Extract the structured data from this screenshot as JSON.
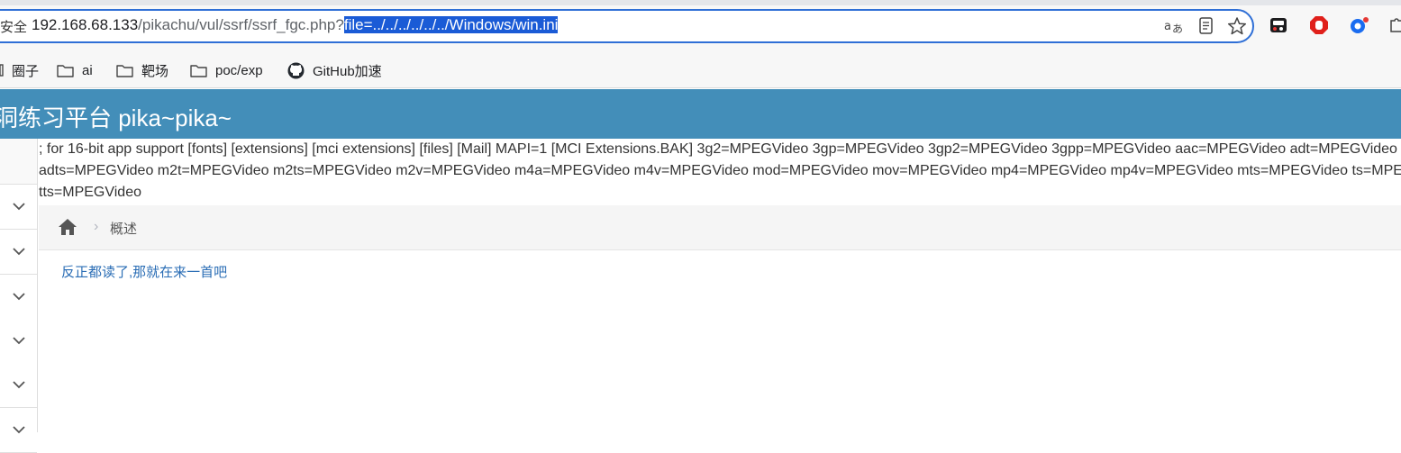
{
  "browser": {
    "security_label": "安全",
    "url_host": "192.168.68.133",
    "url_path": "/pikachu/vul/ssrf/ssrf_fgc.php?",
    "url_selected": "file=../../../../../../Windows/win.ini",
    "icons": [
      "read-aloud-icon",
      "reader-mode-icon",
      "favorite-star-icon",
      "extension-icon",
      "adblock-icon",
      "copilot-icon",
      "extensions-puzzle-icon"
    ]
  },
  "bookmarks": [
    {
      "label": "圈子",
      "icon": "folder-icon"
    },
    {
      "label": "ai",
      "icon": "folder-icon"
    },
    {
      "label": "靶场",
      "icon": "folder-icon"
    },
    {
      "label": "poc/exp",
      "icon": "folder-icon"
    },
    {
      "label": "GitHub加速",
      "icon": "github-icon"
    }
  ],
  "header": {
    "title": "洞练习平台 pika~pika~"
  },
  "output": {
    "lines": [
      "; for 16-bit app support [fonts] [extensions] [mci extensions] [files] [Mail] MAPI=1 [MCI Extensions.BAK] 3g2=MPEGVideo 3gp=MPEGVideo 3gp2=MPEGVideo 3gpp=MPEGVideo aac=MPEGVideo adt=MPEGVideo",
      "adts=MPEGVideo m2t=MPEGVideo m2ts=MPEGVideo m2v=MPEGVideo m4a=MPEGVideo m4v=MPEGVideo mod=MPEGVideo mov=MPEGVideo mp4=MPEGVideo mp4v=MPEGVideo mts=MPEGVideo ts=MPEGVideo",
      "tts=MPEGVideo"
    ]
  },
  "breadcrumb": {
    "separator": "›",
    "current": "概述"
  },
  "content": {
    "link_text": "反正都读了,那就在来一首吧"
  },
  "colors": {
    "header_bg": "#438eb9",
    "url_border": "#2f6fd6",
    "selection_bg": "#1a5bd6",
    "link": "#2a6db5"
  }
}
